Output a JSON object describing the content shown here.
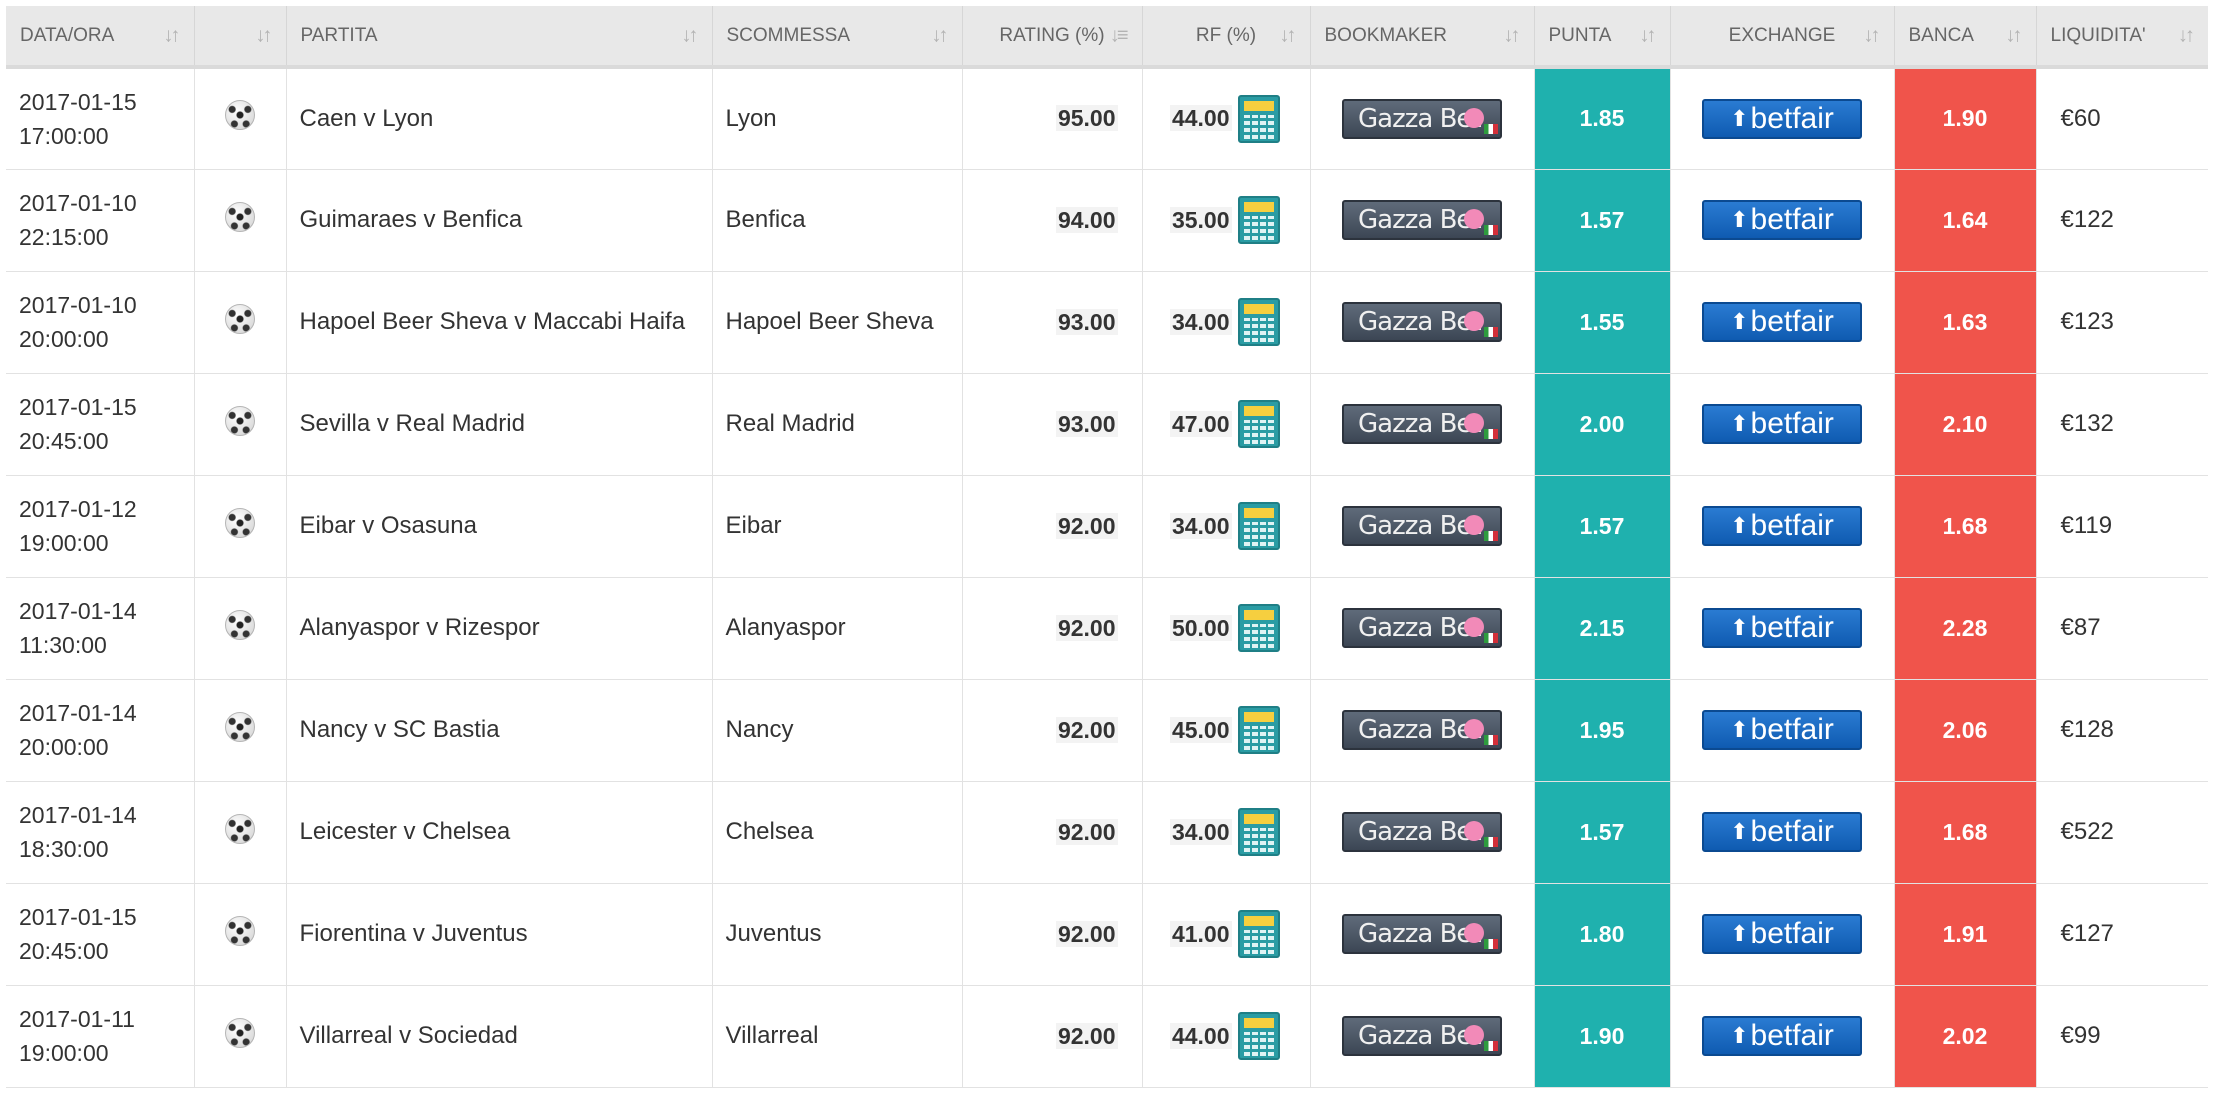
{
  "columns": [
    {
      "label": "DATA/ORA",
      "sort": "sort-icon"
    },
    {
      "label": "",
      "sort": "sort-icon"
    },
    {
      "label": "PARTITA",
      "sort": "sort-icon"
    },
    {
      "label": "SCOMMESSA",
      "sort": "sort-icon"
    },
    {
      "label": "RATING (%)",
      "sort": "sort-desc-icon"
    },
    {
      "label": "RF (%)",
      "sort": "sort-icon"
    },
    {
      "label": "BOOKMAKER",
      "sort": "sort-icon"
    },
    {
      "label": "PUNTA",
      "sort": "sort-icon"
    },
    {
      "label": "EXCHANGE",
      "sort": "sort-icon"
    },
    {
      "label": "BANCA",
      "sort": "sort-icon"
    },
    {
      "label": "LIQUIDITA'",
      "sort": "sort-icon"
    }
  ],
  "bookmaker_logo": {
    "text": "Gazza Bet",
    "icon": "gazzabet-logo"
  },
  "exchange_logo": {
    "text": "betfair",
    "icon": "betfair-logo"
  },
  "colors": {
    "punta": "#1fb1ae",
    "banca": "#f0544b",
    "header": "#e8e8e8"
  },
  "rows": [
    {
      "date": "2017-01-15",
      "time": "17:00:00",
      "match": "Caen v Lyon",
      "bet": "Lyon",
      "rating": "95.00",
      "rf": "44.00",
      "punta": "1.85",
      "banca": "1.90",
      "liquidity": "€60"
    },
    {
      "date": "2017-01-10",
      "time": "22:15:00",
      "match": "Guimaraes v Benfica",
      "bet": "Benfica",
      "rating": "94.00",
      "rf": "35.00",
      "punta": "1.57",
      "banca": "1.64",
      "liquidity": "€122"
    },
    {
      "date": "2017-01-10",
      "time": "20:00:00",
      "match": "Hapoel Beer Sheva v Maccabi Haifa",
      "bet": "Hapoel Beer Sheva",
      "rating": "93.00",
      "rf": "34.00",
      "punta": "1.55",
      "banca": "1.63",
      "liquidity": "€123"
    },
    {
      "date": "2017-01-15",
      "time": "20:45:00",
      "match": "Sevilla v Real Madrid",
      "bet": "Real Madrid",
      "rating": "93.00",
      "rf": "47.00",
      "punta": "2.00",
      "banca": "2.10",
      "liquidity": "€132"
    },
    {
      "date": "2017-01-12",
      "time": "19:00:00",
      "match": "Eibar v Osasuna",
      "bet": "Eibar",
      "rating": "92.00",
      "rf": "34.00",
      "punta": "1.57",
      "banca": "1.68",
      "liquidity": "€119"
    },
    {
      "date": "2017-01-14",
      "time": "11:30:00",
      "match": "Alanyaspor v Rizespor",
      "bet": "Alanyaspor",
      "rating": "92.00",
      "rf": "50.00",
      "punta": "2.15",
      "banca": "2.28",
      "liquidity": "€87"
    },
    {
      "date": "2017-01-14",
      "time": "20:00:00",
      "match": "Nancy v SC Bastia",
      "bet": "Nancy",
      "rating": "92.00",
      "rf": "45.00",
      "punta": "1.95",
      "banca": "2.06",
      "liquidity": "€128"
    },
    {
      "date": "2017-01-14",
      "time": "18:30:00",
      "match": "Leicester v Chelsea",
      "bet": "Chelsea",
      "rating": "92.00",
      "rf": "34.00",
      "punta": "1.57",
      "banca": "1.68",
      "liquidity": "€522"
    },
    {
      "date": "2017-01-15",
      "time": "20:45:00",
      "match": "Fiorentina v Juventus",
      "bet": "Juventus",
      "rating": "92.00",
      "rf": "41.00",
      "punta": "1.80",
      "banca": "1.91",
      "liquidity": "€127"
    },
    {
      "date": "2017-01-11",
      "time": "19:00:00",
      "match": "Villarreal v Sociedad",
      "bet": "Villarreal",
      "rating": "92.00",
      "rf": "44.00",
      "punta": "1.90",
      "banca": "2.02",
      "liquidity": "€99"
    }
  ]
}
